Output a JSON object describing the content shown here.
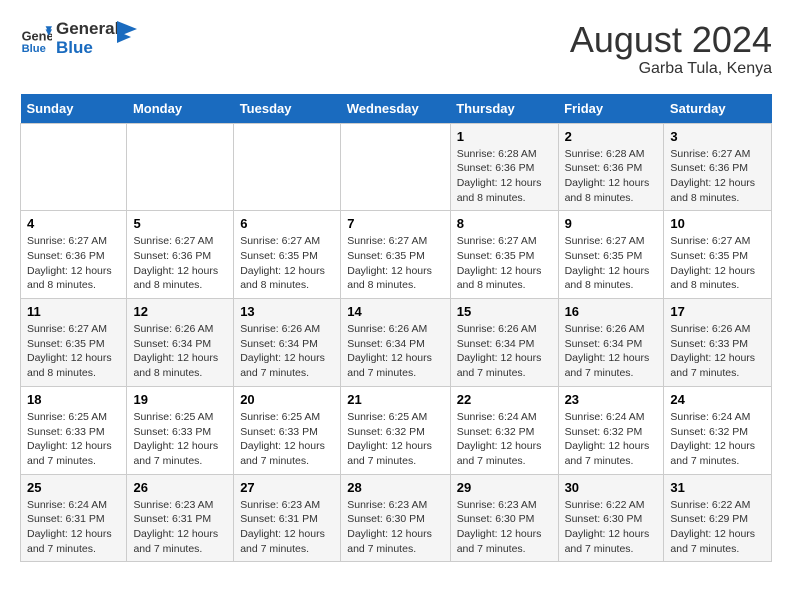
{
  "header": {
    "logo_line1": "General",
    "logo_line2": "Blue",
    "month_year": "August 2024",
    "location": "Garba Tula, Kenya"
  },
  "days_of_week": [
    "Sunday",
    "Monday",
    "Tuesday",
    "Wednesday",
    "Thursday",
    "Friday",
    "Saturday"
  ],
  "weeks": [
    [
      {
        "day": "",
        "info": ""
      },
      {
        "day": "",
        "info": ""
      },
      {
        "day": "",
        "info": ""
      },
      {
        "day": "",
        "info": ""
      },
      {
        "day": "1",
        "info": "Sunrise: 6:28 AM\nSunset: 6:36 PM\nDaylight: 12 hours and 8 minutes."
      },
      {
        "day": "2",
        "info": "Sunrise: 6:28 AM\nSunset: 6:36 PM\nDaylight: 12 hours and 8 minutes."
      },
      {
        "day": "3",
        "info": "Sunrise: 6:27 AM\nSunset: 6:36 PM\nDaylight: 12 hours and 8 minutes."
      }
    ],
    [
      {
        "day": "4",
        "info": "Sunrise: 6:27 AM\nSunset: 6:36 PM\nDaylight: 12 hours and 8 minutes."
      },
      {
        "day": "5",
        "info": "Sunrise: 6:27 AM\nSunset: 6:36 PM\nDaylight: 12 hours and 8 minutes."
      },
      {
        "day": "6",
        "info": "Sunrise: 6:27 AM\nSunset: 6:35 PM\nDaylight: 12 hours and 8 minutes."
      },
      {
        "day": "7",
        "info": "Sunrise: 6:27 AM\nSunset: 6:35 PM\nDaylight: 12 hours and 8 minutes."
      },
      {
        "day": "8",
        "info": "Sunrise: 6:27 AM\nSunset: 6:35 PM\nDaylight: 12 hours and 8 minutes."
      },
      {
        "day": "9",
        "info": "Sunrise: 6:27 AM\nSunset: 6:35 PM\nDaylight: 12 hours and 8 minutes."
      },
      {
        "day": "10",
        "info": "Sunrise: 6:27 AM\nSunset: 6:35 PM\nDaylight: 12 hours and 8 minutes."
      }
    ],
    [
      {
        "day": "11",
        "info": "Sunrise: 6:27 AM\nSunset: 6:35 PM\nDaylight: 12 hours and 8 minutes."
      },
      {
        "day": "12",
        "info": "Sunrise: 6:26 AM\nSunset: 6:34 PM\nDaylight: 12 hours and 8 minutes."
      },
      {
        "day": "13",
        "info": "Sunrise: 6:26 AM\nSunset: 6:34 PM\nDaylight: 12 hours and 7 minutes."
      },
      {
        "day": "14",
        "info": "Sunrise: 6:26 AM\nSunset: 6:34 PM\nDaylight: 12 hours and 7 minutes."
      },
      {
        "day": "15",
        "info": "Sunrise: 6:26 AM\nSunset: 6:34 PM\nDaylight: 12 hours and 7 minutes."
      },
      {
        "day": "16",
        "info": "Sunrise: 6:26 AM\nSunset: 6:34 PM\nDaylight: 12 hours and 7 minutes."
      },
      {
        "day": "17",
        "info": "Sunrise: 6:26 AM\nSunset: 6:33 PM\nDaylight: 12 hours and 7 minutes."
      }
    ],
    [
      {
        "day": "18",
        "info": "Sunrise: 6:25 AM\nSunset: 6:33 PM\nDaylight: 12 hours and 7 minutes."
      },
      {
        "day": "19",
        "info": "Sunrise: 6:25 AM\nSunset: 6:33 PM\nDaylight: 12 hours and 7 minutes."
      },
      {
        "day": "20",
        "info": "Sunrise: 6:25 AM\nSunset: 6:33 PM\nDaylight: 12 hours and 7 minutes."
      },
      {
        "day": "21",
        "info": "Sunrise: 6:25 AM\nSunset: 6:32 PM\nDaylight: 12 hours and 7 minutes."
      },
      {
        "day": "22",
        "info": "Sunrise: 6:24 AM\nSunset: 6:32 PM\nDaylight: 12 hours and 7 minutes."
      },
      {
        "day": "23",
        "info": "Sunrise: 6:24 AM\nSunset: 6:32 PM\nDaylight: 12 hours and 7 minutes."
      },
      {
        "day": "24",
        "info": "Sunrise: 6:24 AM\nSunset: 6:32 PM\nDaylight: 12 hours and 7 minutes."
      }
    ],
    [
      {
        "day": "25",
        "info": "Sunrise: 6:24 AM\nSunset: 6:31 PM\nDaylight: 12 hours and 7 minutes."
      },
      {
        "day": "26",
        "info": "Sunrise: 6:23 AM\nSunset: 6:31 PM\nDaylight: 12 hours and 7 minutes."
      },
      {
        "day": "27",
        "info": "Sunrise: 6:23 AM\nSunset: 6:31 PM\nDaylight: 12 hours and 7 minutes."
      },
      {
        "day": "28",
        "info": "Sunrise: 6:23 AM\nSunset: 6:30 PM\nDaylight: 12 hours and 7 minutes."
      },
      {
        "day": "29",
        "info": "Sunrise: 6:23 AM\nSunset: 6:30 PM\nDaylight: 12 hours and 7 minutes."
      },
      {
        "day": "30",
        "info": "Sunrise: 6:22 AM\nSunset: 6:30 PM\nDaylight: 12 hours and 7 minutes."
      },
      {
        "day": "31",
        "info": "Sunrise: 6:22 AM\nSunset: 6:29 PM\nDaylight: 12 hours and 7 minutes."
      }
    ]
  ]
}
